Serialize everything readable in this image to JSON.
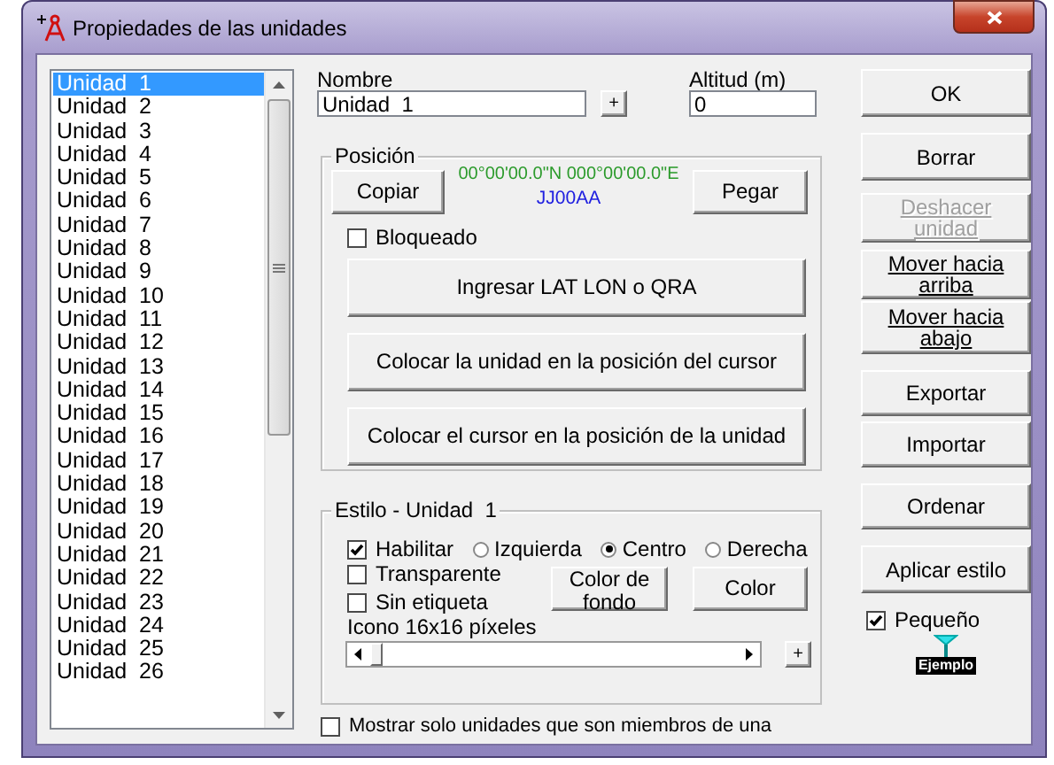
{
  "window": {
    "title": "Propiedades de las unidades"
  },
  "units": [
    {
      "label": "Unidad  1",
      "selected": true
    },
    {
      "label": "Unidad  2",
      "selected": false
    },
    {
      "label": "Unidad  3",
      "selected": false
    },
    {
      "label": "Unidad  4",
      "selected": false
    },
    {
      "label": "Unidad  5",
      "selected": false
    },
    {
      "label": "Unidad  6",
      "selected": false
    },
    {
      "label": "Unidad  7",
      "selected": false
    },
    {
      "label": "Unidad  8",
      "selected": false
    },
    {
      "label": "Unidad  9",
      "selected": false
    },
    {
      "label": "Unidad  10",
      "selected": false
    },
    {
      "label": "Unidad  11",
      "selected": false
    },
    {
      "label": "Unidad  12",
      "selected": false
    },
    {
      "label": "Unidad  13",
      "selected": false
    },
    {
      "label": "Unidad  14",
      "selected": false
    },
    {
      "label": "Unidad  15",
      "selected": false
    },
    {
      "label": "Unidad  16",
      "selected": false
    },
    {
      "label": "Unidad  17",
      "selected": false
    },
    {
      "label": "Unidad  18",
      "selected": false
    },
    {
      "label": "Unidad  19",
      "selected": false
    },
    {
      "label": "Unidad  20",
      "selected": false
    },
    {
      "label": "Unidad  21",
      "selected": false
    },
    {
      "label": "Unidad  22",
      "selected": false
    },
    {
      "label": "Unidad  23",
      "selected": false
    },
    {
      "label": "Unidad  24",
      "selected": false
    },
    {
      "label": "Unidad  25",
      "selected": false
    },
    {
      "label": "Unidad  26",
      "selected": false
    }
  ],
  "name_field": {
    "label": "Nombre",
    "value": "Unidad  1"
  },
  "add_button": "+",
  "altitude_field": {
    "label": "Altitud (m)",
    "value": "0"
  },
  "position": {
    "title": "Posición",
    "copy_button": "Copiar",
    "coordinates": "00°00'00.0\"N 000°00'00.0\"E",
    "locator": "JJ00AA",
    "paste_button": "Pegar",
    "locked": {
      "label": "Bloqueado",
      "checked": false
    },
    "actions": [
      "Ingresar LAT LON o QRA",
      "Colocar la unidad en la posición del cursor",
      "Colocar el cursor en la posición de la unidad"
    ]
  },
  "style": {
    "title": "Estilo - Unidad  1",
    "enable": {
      "label": "Habilitar",
      "checked": true
    },
    "alignments": [
      {
        "label": "Izquierda",
        "selected": false
      },
      {
        "label": "Centro",
        "selected": true
      },
      {
        "label": "Derecha",
        "selected": false
      }
    ],
    "transparent": {
      "label": "Transparente",
      "checked": false
    },
    "no_label": {
      "label": "Sin etiqueta",
      "checked": false
    },
    "bg_color_button": "Color de fondo",
    "color_button": "Color",
    "icon_size_label": "Icono 16x16 píxeles",
    "plus_button": "+"
  },
  "members_only": {
    "label": "Mostrar solo unidades que son miembros de una",
    "checked": false
  },
  "buttons": [
    {
      "label": "OK",
      "disabled": false
    },
    {
      "label": "Borrar",
      "disabled": false
    },
    {
      "label": "Deshacer unidad",
      "disabled": true
    },
    {
      "label": "Mover hacia arriba",
      "disabled": false
    },
    {
      "label": "Mover hacia abajo",
      "disabled": false
    },
    {
      "label": "Exportar",
      "disabled": false
    },
    {
      "label": "Importar",
      "disabled": false
    },
    {
      "label": "Ordenar",
      "disabled": false
    },
    {
      "label": "Aplicar estilo",
      "disabled": false
    }
  ],
  "small": {
    "label": "Pequeño",
    "checked": true
  },
  "sample_label": "Ejemplo"
}
